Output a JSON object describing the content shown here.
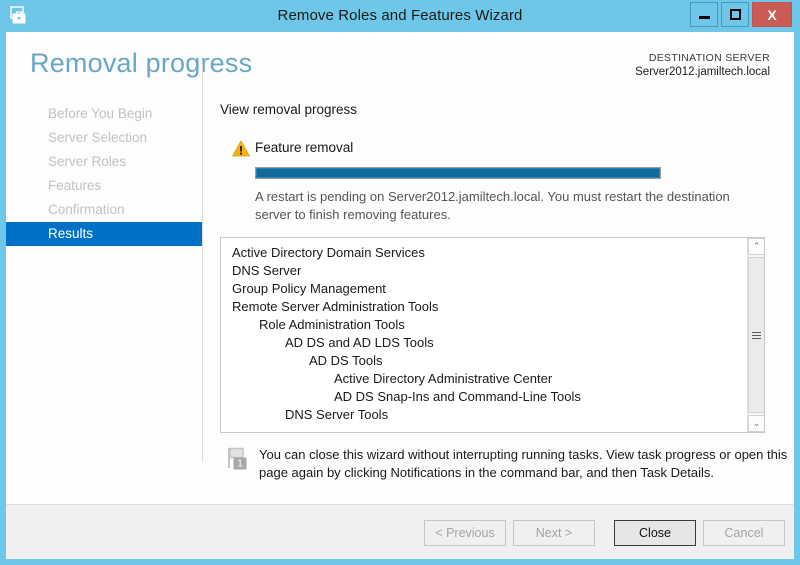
{
  "window": {
    "title": "Remove Roles and Features Wizard",
    "icon": "server-manager-icon",
    "border_color": "#6ec6e8",
    "caption": {
      "minimize_label": "–",
      "maximize_label": "□",
      "close_label": "X",
      "close_color": "#cc5a55"
    }
  },
  "header": {
    "page_title": "Removal progress",
    "page_title_color": "#6ba5c7",
    "destination_label": "DESTINATION SERVER",
    "destination_value": "Server2012.jamiltech.local"
  },
  "sidebar": {
    "selected_color": "#0072c6",
    "items": [
      {
        "label": "Before You Begin",
        "selected": false
      },
      {
        "label": "Server Selection",
        "selected": false
      },
      {
        "label": "Server Roles",
        "selected": false
      },
      {
        "label": "Features",
        "selected": false
      },
      {
        "label": "Confirmation",
        "selected": false
      },
      {
        "label": "Results",
        "selected": true
      }
    ]
  },
  "main": {
    "section_label": "View removal progress",
    "progress": {
      "icon": "warning-triangle-icon",
      "title": "Feature removal",
      "percent": 100,
      "fill_color": "#12699b",
      "note": "A restart is pending on Server2012.jamiltech.local. You must restart the destination server to finish removing features."
    },
    "removal_list": [
      {
        "label": "Active Directory Domain Services",
        "indent": 0
      },
      {
        "label": "DNS Server",
        "indent": 0
      },
      {
        "label": "Group Policy Management",
        "indent": 0
      },
      {
        "label": "Remote Server Administration Tools",
        "indent": 0
      },
      {
        "label": "Role Administration Tools",
        "indent": 1
      },
      {
        "label": "AD DS and AD LDS Tools",
        "indent": 2
      },
      {
        "label": "AD DS Tools",
        "indent": 3
      },
      {
        "label": "Active Directory Administrative Center",
        "indent": 4
      },
      {
        "label": "AD DS Snap-Ins and Command-Line Tools",
        "indent": 4
      },
      {
        "label": "DNS Server Tools",
        "indent": 2
      }
    ],
    "scrollbar": {
      "up_arrow": "⌃",
      "down_arrow": "⌄"
    },
    "footnote": {
      "icon": "notification-flag-icon",
      "badge": "1",
      "text": "You can close this wizard without interrupting running tasks. View task progress or open this page again by clicking Notifications in the command bar, and then Task Details."
    }
  },
  "footer": {
    "buttons": [
      {
        "id": "previous",
        "label": "< Previous",
        "enabled": false
      },
      {
        "id": "next",
        "label": "Next >",
        "enabled": false
      },
      {
        "id": "close",
        "label": "Close",
        "enabled": true
      },
      {
        "id": "cancel",
        "label": "Cancel",
        "enabled": false
      }
    ]
  }
}
